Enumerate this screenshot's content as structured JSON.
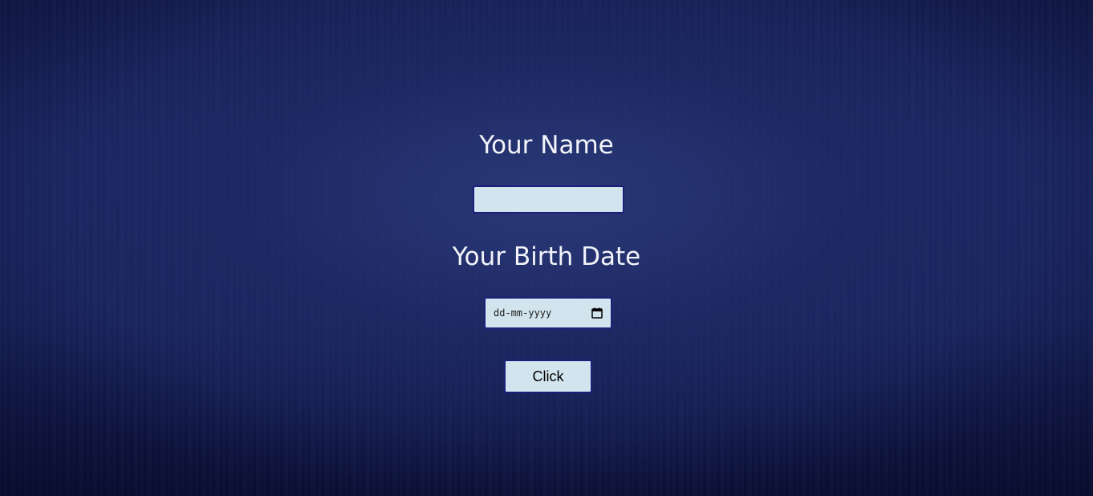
{
  "form": {
    "name_label": "Your Name",
    "name_value": "",
    "birth_label": "Your Birth Date",
    "date_placeholder": "dd-mm-yyyy",
    "date_icon": "calendar-icon",
    "submit_label": "Click"
  },
  "colors": {
    "background": "#1a2460",
    "label_text": "#f2f4fa",
    "field_fill": "#d2e4ed",
    "field_border": "#1b1f7a"
  }
}
